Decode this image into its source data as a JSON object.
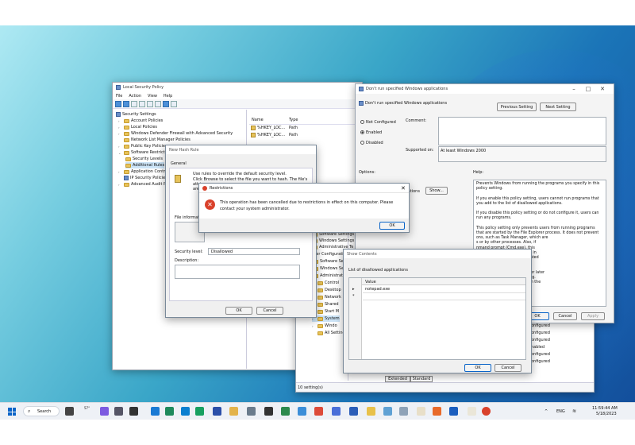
{
  "lsp": {
    "title": "Local Security Policy",
    "menu": [
      "File",
      "Action",
      "View",
      "Help"
    ],
    "tree": [
      "Security Settings",
      "Account Policies",
      "Local Policies",
      "Windows Defender Firewall with Advanced Security",
      "Network List Manager Policies",
      "Public Key Policies",
      "Software Restriction",
      "Security Levels",
      "Additional Rules",
      "Application Control",
      "IP Security Policies",
      "Advanced Audit P"
    ],
    "columns": [
      "Name",
      "Type"
    ],
    "rows": [
      {
        "name": "%HKEY_LOC...",
        "type": "Path"
      },
      {
        "name": "%HKEY_LOC...",
        "type": "Path"
      }
    ]
  },
  "hash": {
    "title": "New Hash Rule",
    "tab": "General",
    "intro": "Use rules to override the default security level.",
    "intro2": "Click Browse to select the file you want to hash. The file's",
    "intro3": "attri",
    "intro4": "are",
    "file_info_label": "File information",
    "security_level_label": "Security level:",
    "security_level_value": "Disallowed",
    "description_label": "Description:",
    "ok": "OK",
    "cancel": "Cancel"
  },
  "restrict": {
    "title": "Restrictions",
    "message1": "This operation has been cancelled due to restrictions in effect on this computer. Please",
    "message2": "contact your system administrator.",
    "ok": "OK"
  },
  "gp": {
    "title": "Don't run specified Windows applications",
    "header": "Don't run specified Windows applications",
    "prev": "Previous Setting",
    "next": "Next Setting",
    "not_configured": "Not Configured",
    "enabled": "Enabled",
    "disabled": "Disabled",
    "comment": "Comment:",
    "supported_on": "Supported on:",
    "supported_value": "At least Windows 2000",
    "options": "Options:",
    "help": "Help:",
    "list_label": "List of disallowed applications",
    "show": "Show...",
    "help_lines": [
      "Prevents Windows from running the programs you specify in this",
      "policy setting.",
      "",
      "If you enable this policy setting, users cannot run programs that",
      "you add to the list of disallowed applications.",
      "",
      "If you disable this policy setting or do not configure it, users can",
      "run any programs.",
      "",
      "This policy setting only prevents users from running programs",
      "that are started by the File Explorer process. It does not prevent",
      "ons, such as Task Manager, which are",
      "s or by other processes.  Also, if",
      "nmand prompt (Cmd.exe), this",
      "them from starting programs in",
      "though they would be prevented",
      "plorer.",
      "",
      "ications with Windows 2000 or later",
      "comply with this policy setting.",
      "ed applications, click Show.  In the"
    ],
    "ok": "OK",
    "cancel": "Cancel",
    "apply": "Apply"
  },
  "gpe": {
    "tree": [
      "Software Settings",
      "Windows Settings",
      "Administrative Te",
      "User Configuration",
      "Software Se",
      "Windows Se",
      "Administrati",
      "Control",
      "Desktop",
      "Network",
      "Shared",
      "Start M",
      "System",
      "Windo",
      "All Setting"
    ],
    "states": [
      "onfigured",
      "onfigured",
      "onfigured",
      "nabled",
      "onfigured",
      "onfigured"
    ],
    "tabs": [
      "Extended",
      "Standard"
    ],
    "status": "10 setting(s)"
  },
  "show": {
    "title": "Show Contents",
    "label": "List of disallowed applications",
    "col": "Value",
    "row1": "notepad.exe",
    "ok": "OK",
    "cancel": "Cancel"
  },
  "taskbar": {
    "search": "Search",
    "lang": "ENG",
    "time": "11:59:44 AM",
    "date": "5/18/2023",
    "weather": "57°"
  },
  "colors": {
    "accent": "#0a64c8",
    "error": "#d9412b"
  }
}
